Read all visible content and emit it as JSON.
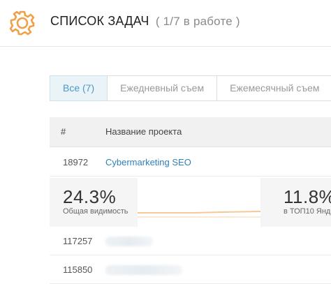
{
  "header": {
    "title": "СПИСОК ЗАДАЧ",
    "status": "( 1/7 в работе )",
    "accent_color": "#f0a046",
    "icon": "gear-icon"
  },
  "tabs": [
    {
      "label": "Все (7)",
      "active": true
    },
    {
      "label": "Ежедневный съем",
      "active": false
    },
    {
      "label": "Ежемесячный съем",
      "active": false
    }
  ],
  "table": {
    "columns": [
      "#",
      "Название проекта"
    ],
    "rows": [
      {
        "id": "18972",
        "name": "Cybermarketing SEO"
      },
      {
        "id": "117257",
        "name": ""
      },
      {
        "id": "115850",
        "name": ""
      }
    ]
  },
  "stats": {
    "visibility_value": "24.3%",
    "visibility_label": "Общая видимость",
    "top10_value": "11.8%",
    "top10_label": "в ТОП10 Янд"
  }
}
